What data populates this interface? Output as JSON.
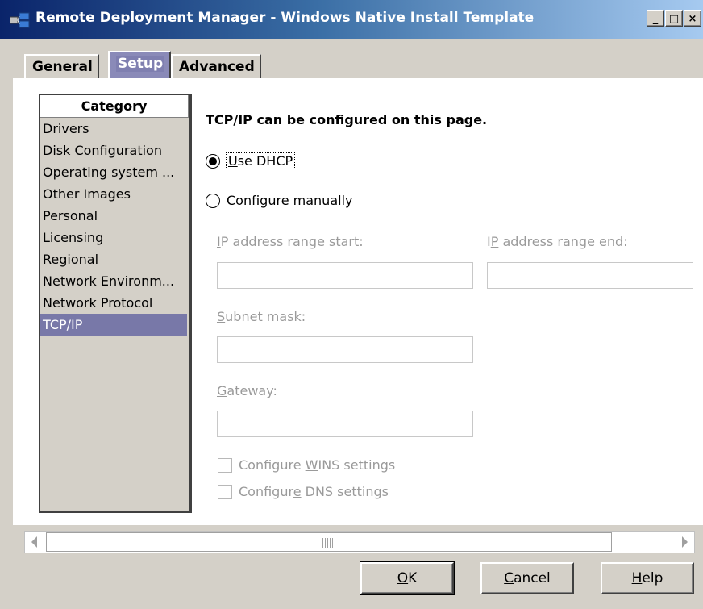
{
  "window": {
    "title": "Remote Deployment Manager - Windows Native Install Template",
    "controls": {
      "minimize": "_",
      "maximize": "□",
      "close": "×"
    }
  },
  "tabs": [
    {
      "label": "General",
      "active": false
    },
    {
      "label": "Setup",
      "active": true
    },
    {
      "label": "Advanced",
      "active": false
    }
  ],
  "category": {
    "header": "Category",
    "items": [
      "Drivers",
      "Disk Configuration",
      "Operating system ...",
      "Other Images",
      "Personal",
      "Licensing",
      "Regional",
      "Network Environm...",
      "Network Protocol",
      "TCP/IP"
    ],
    "selected_index": 9
  },
  "content": {
    "heading": "TCP/IP can be configured on this page.",
    "dhcp": {
      "mnemonic": "U",
      "label_rest": "se DHCP",
      "selected": true
    },
    "manual": {
      "pre": "Configure ",
      "mnemonic": "m",
      "post": "anually",
      "selected": false
    },
    "ip_start": {
      "mnemonic": "I",
      "label_rest": "P address range start:",
      "value": ""
    },
    "ip_end": {
      "pre": "I",
      "mnemonic": "P",
      "post": " address range end:",
      "value": ""
    },
    "subnet": {
      "mnemonic": "S",
      "label_rest": "ubnet mask:",
      "value": ""
    },
    "gateway": {
      "mnemonic": "G",
      "label_rest": "ateway:",
      "value": ""
    },
    "wins": {
      "pre": "Configure ",
      "mnemonic": "W",
      "post": "INS settings",
      "checked": false
    },
    "dns": {
      "pre": "Configur",
      "mnemonic": "e",
      "post": " DNS settings",
      "checked": false
    }
  },
  "buttons": {
    "ok": {
      "mnemonic": "O",
      "rest": "K"
    },
    "cancel": {
      "mnemonic": "C",
      "rest": "ancel"
    },
    "help": {
      "mnemonic": "H",
      "rest": "elp"
    }
  },
  "colors": {
    "title_start": "#0a246a",
    "title_end": "#a6caf0",
    "selection": "#7878a8",
    "disabled_text": "#9a9a9a",
    "face": "#d4d0c8"
  }
}
